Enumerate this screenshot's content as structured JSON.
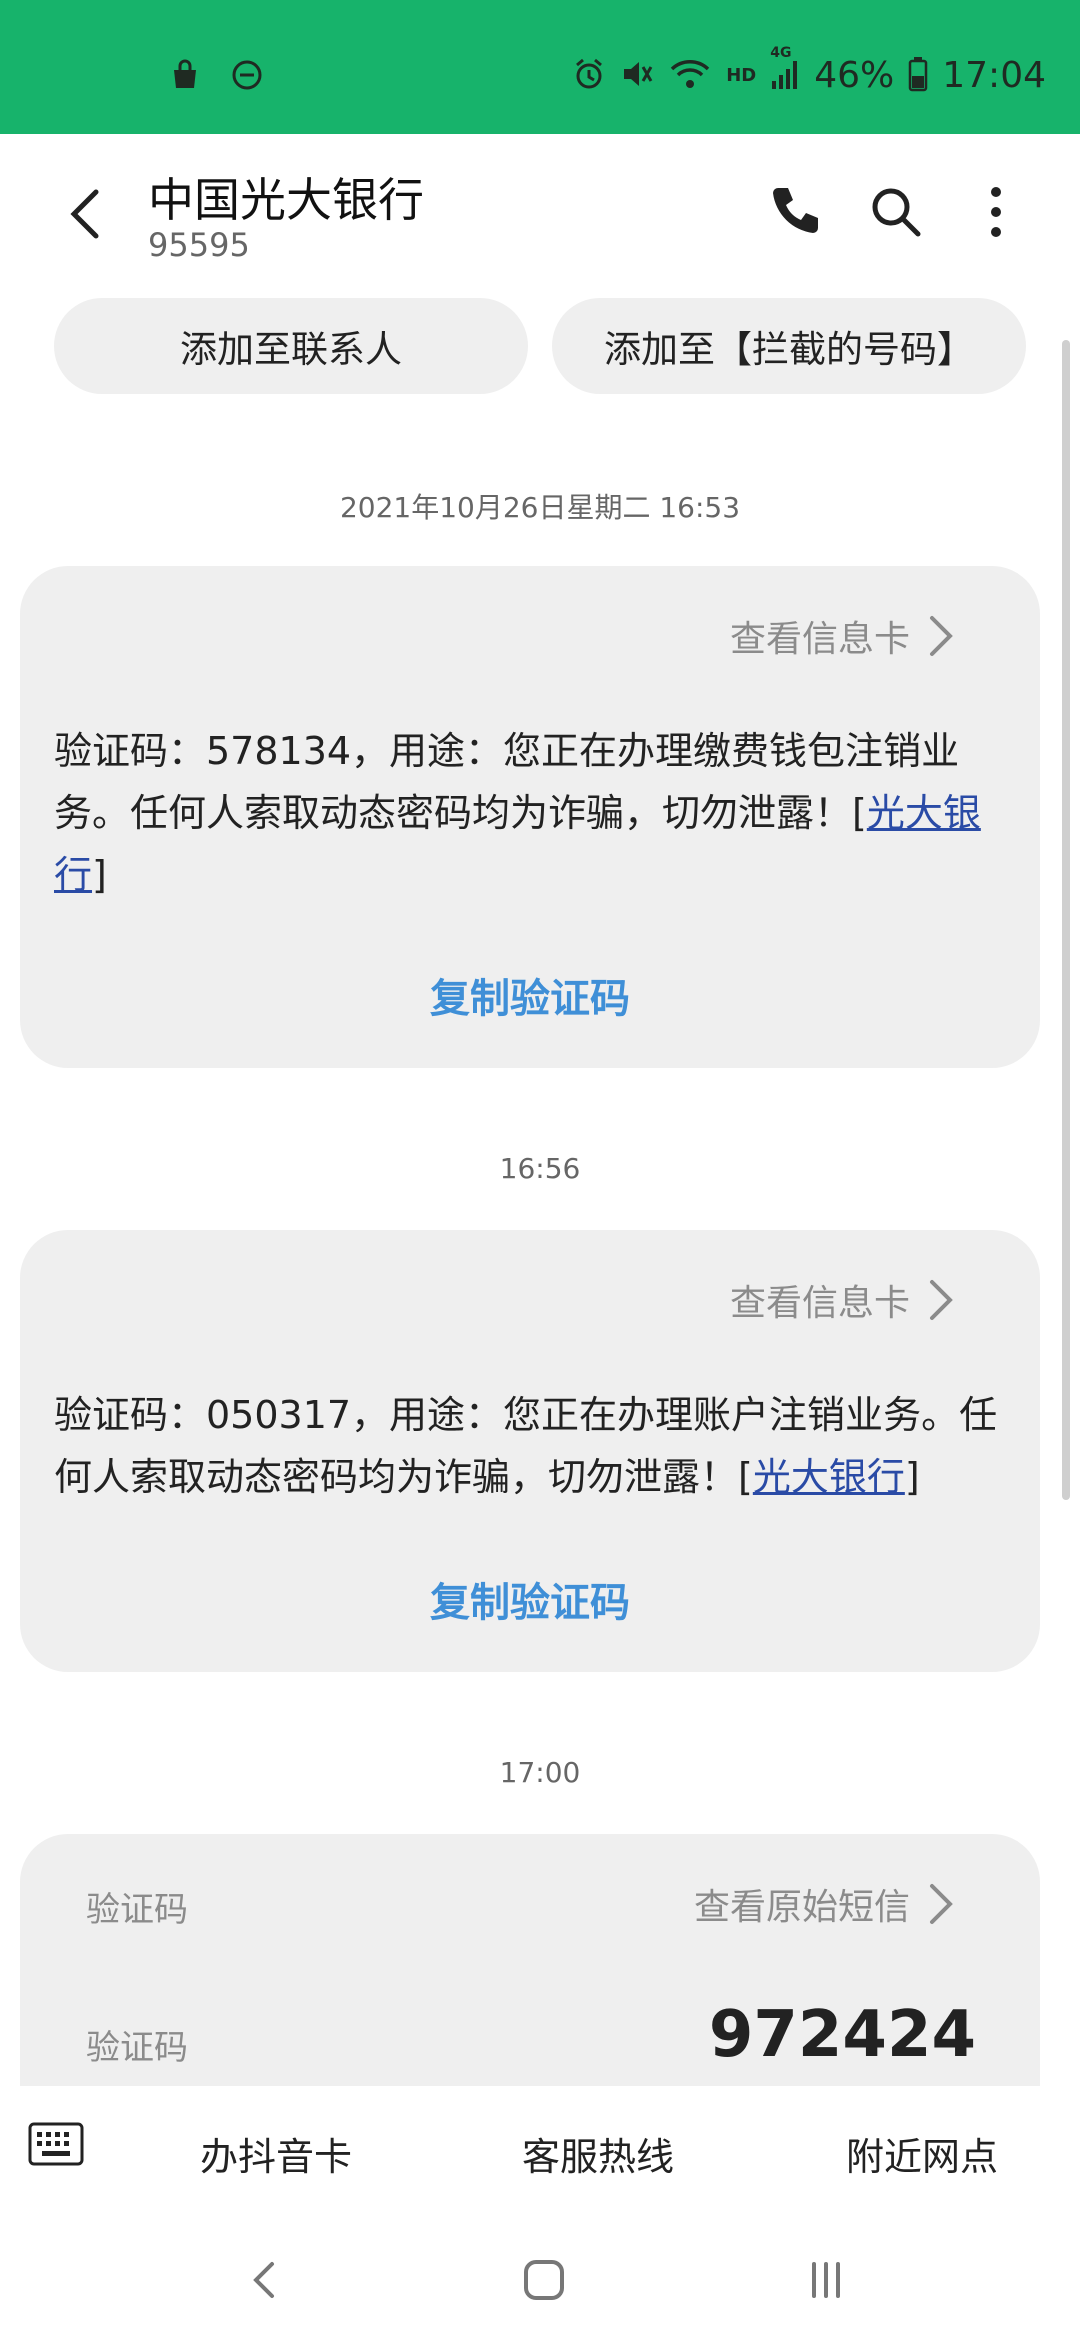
{
  "status_bar": {
    "time": "17:04",
    "battery": "46%",
    "network_hd": "HD",
    "network_type": "4G",
    "icons": [
      "shopping-bag-icon",
      "do-not-disturb-icon",
      "alarm-icon",
      "mute-icon",
      "wifi-icon",
      "signal-icon",
      "battery-icon"
    ]
  },
  "header": {
    "title": "中国光大银行",
    "subtitle": "95595"
  },
  "actions": {
    "add_contact": "添加至联系人",
    "add_blocked": "添加至【拦截的号码】"
  },
  "messages": [
    {
      "timestamp": "2021年10月26日星期二 16:53",
      "view_card": "查看信息卡",
      "text_before": "验证码：578134，用途：您正在办理缴费钱包注销业务。任何人索取动态密码均为诈骗，切勿泄露！[",
      "link": "光大银行",
      "text_after": "]",
      "copy": "复制验证码"
    },
    {
      "timestamp": "16:56",
      "view_card": "查看信息卡",
      "text_before": "验证码：050317，用途：您正在办理账户注销业务。任何人索取动态密码均为诈骗，切勿泄露！[",
      "link": "光大银行",
      "text_after": "]",
      "copy": "复制验证码"
    }
  ],
  "otp_card": {
    "timestamp": "17:00",
    "header_label": "验证码",
    "view_original": "查看原始短信",
    "row_label": "验证码",
    "code": "972424"
  },
  "quick_bar": {
    "item1": "办抖音卡",
    "item2": "客服热线",
    "item3": "附近网点"
  },
  "colors": {
    "status_bar": "#17b36b",
    "bubble": "#efefef",
    "link": "#2a4ba6",
    "copy_button": "#3f8fd7"
  }
}
